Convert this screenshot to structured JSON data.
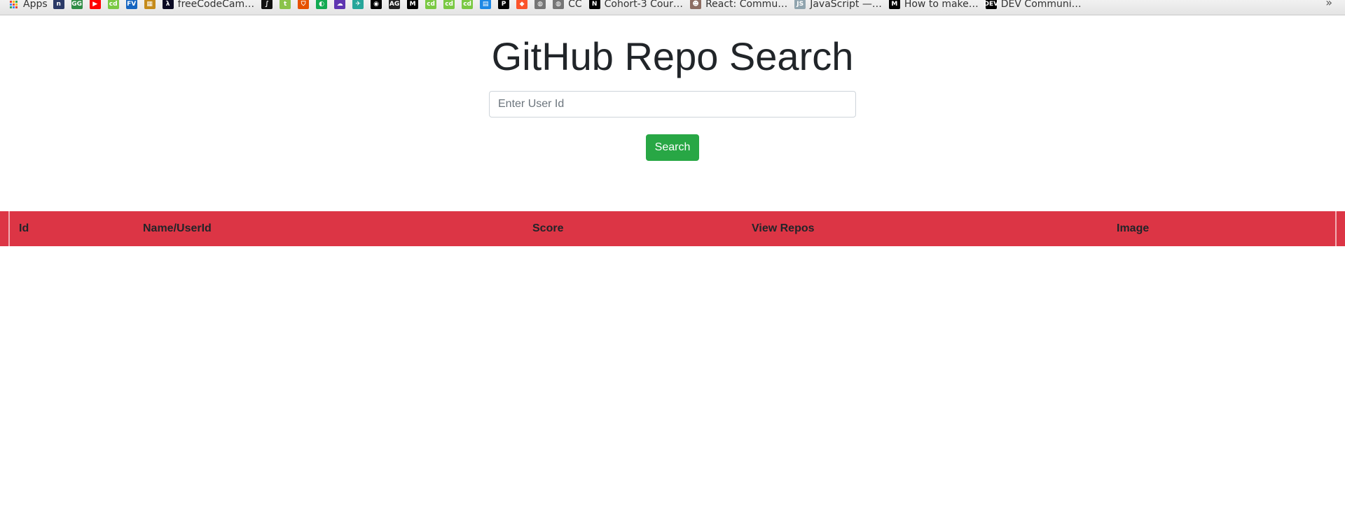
{
  "bookmarks": {
    "apps_label": "Apps",
    "items": [
      {
        "icon": "bookmark-icon-dark",
        "label": "",
        "color": "#2b3a67",
        "glyph": "n"
      },
      {
        "icon": "geeksforgeeks-icon",
        "label": "",
        "color": "#2f8d46",
        "glyph": "GG"
      },
      {
        "icon": "youtube-icon",
        "label": "",
        "color": "#ff0000",
        "glyph": "▶"
      },
      {
        "icon": "codeforces-icon",
        "label": "",
        "color": "#7ac943",
        "glyph": "cd"
      },
      {
        "icon": "fv-icon",
        "label": "",
        "color": "#1565c0",
        "glyph": "FV"
      },
      {
        "icon": "pattern-icon",
        "label": "",
        "color": "#c58b1b",
        "glyph": "▦"
      },
      {
        "icon": "freecodecamp-icon",
        "label": "freeCodeCam…",
        "color": "#0a0a23",
        "glyph": "λ"
      },
      {
        "icon": "dark-circle-icon",
        "label": "",
        "color": "#111111",
        "glyph": "∫"
      },
      {
        "icon": "tumblr-icon",
        "label": "",
        "color": "#8bc34a",
        "glyph": "t"
      },
      {
        "icon": "shield-icon",
        "label": "",
        "color": "#e65100",
        "glyph": "⛉"
      },
      {
        "icon": "mongodb-icon",
        "label": "",
        "color": "#13aa52",
        "glyph": "◐"
      },
      {
        "icon": "cloud-icon",
        "label": "",
        "color": "#5e35b1",
        "glyph": "☁"
      },
      {
        "icon": "bird-icon",
        "label": "",
        "color": "#26a69a",
        "glyph": "✈"
      },
      {
        "icon": "github-icon",
        "label": "",
        "color": "#000000",
        "glyph": "◉"
      },
      {
        "icon": "afg-icon",
        "label": "",
        "color": "#222222",
        "glyph": "AG"
      },
      {
        "icon": "medium-icon",
        "label": "",
        "color": "#000000",
        "glyph": "M"
      },
      {
        "icon": "codeforces-icon-2",
        "label": "",
        "color": "#7ac943",
        "glyph": "cd"
      },
      {
        "icon": "codeforces-icon-3",
        "label": "",
        "color": "#7ac943",
        "glyph": "cd"
      },
      {
        "icon": "codeforces-icon-4",
        "label": "",
        "color": "#7ac943",
        "glyph": "cd"
      },
      {
        "icon": "blue-square-icon",
        "label": "",
        "color": "#1e88e5",
        "glyph": "▤"
      },
      {
        "icon": "p-icon",
        "label": "",
        "color": "#000000",
        "glyph": "P"
      },
      {
        "icon": "brave-icon",
        "label": "",
        "color": "#fb542b",
        "glyph": "◆"
      },
      {
        "icon": "globe-icon",
        "label": "",
        "color": "#757575",
        "glyph": "◍"
      },
      {
        "icon": "globe-icon-2",
        "label": "CC",
        "color": "#757575",
        "glyph": "◍"
      },
      {
        "icon": "notion-icon",
        "label": "Cohort-3 Cour…",
        "color": "#000000",
        "glyph": "N"
      },
      {
        "icon": "reactiflux-icon",
        "label": "React: Commu…",
        "color": "#8d6e63",
        "glyph": "☻"
      },
      {
        "icon": "javascript-icon",
        "label": "JavaScript —…",
        "color": "#90a4ae",
        "glyph": "JS"
      },
      {
        "icon": "medium-icon-2",
        "label": "How to make…",
        "color": "#000000",
        "glyph": "M"
      },
      {
        "icon": "dev-icon",
        "label": "DEV Communi…",
        "color": "#000000",
        "glyph": "DEV"
      }
    ],
    "more_label": "»"
  },
  "page": {
    "title": "GitHub Repo Search"
  },
  "search": {
    "placeholder": "Enter User Id",
    "value": "",
    "button_label": "Search"
  },
  "table": {
    "headers": [
      "Id",
      "Name/UserId",
      "Score",
      "View Repos",
      "Image"
    ],
    "rows": []
  },
  "colors": {
    "header_bg": "#dc3545",
    "button_bg": "#28a745",
    "title_color": "#212529"
  }
}
